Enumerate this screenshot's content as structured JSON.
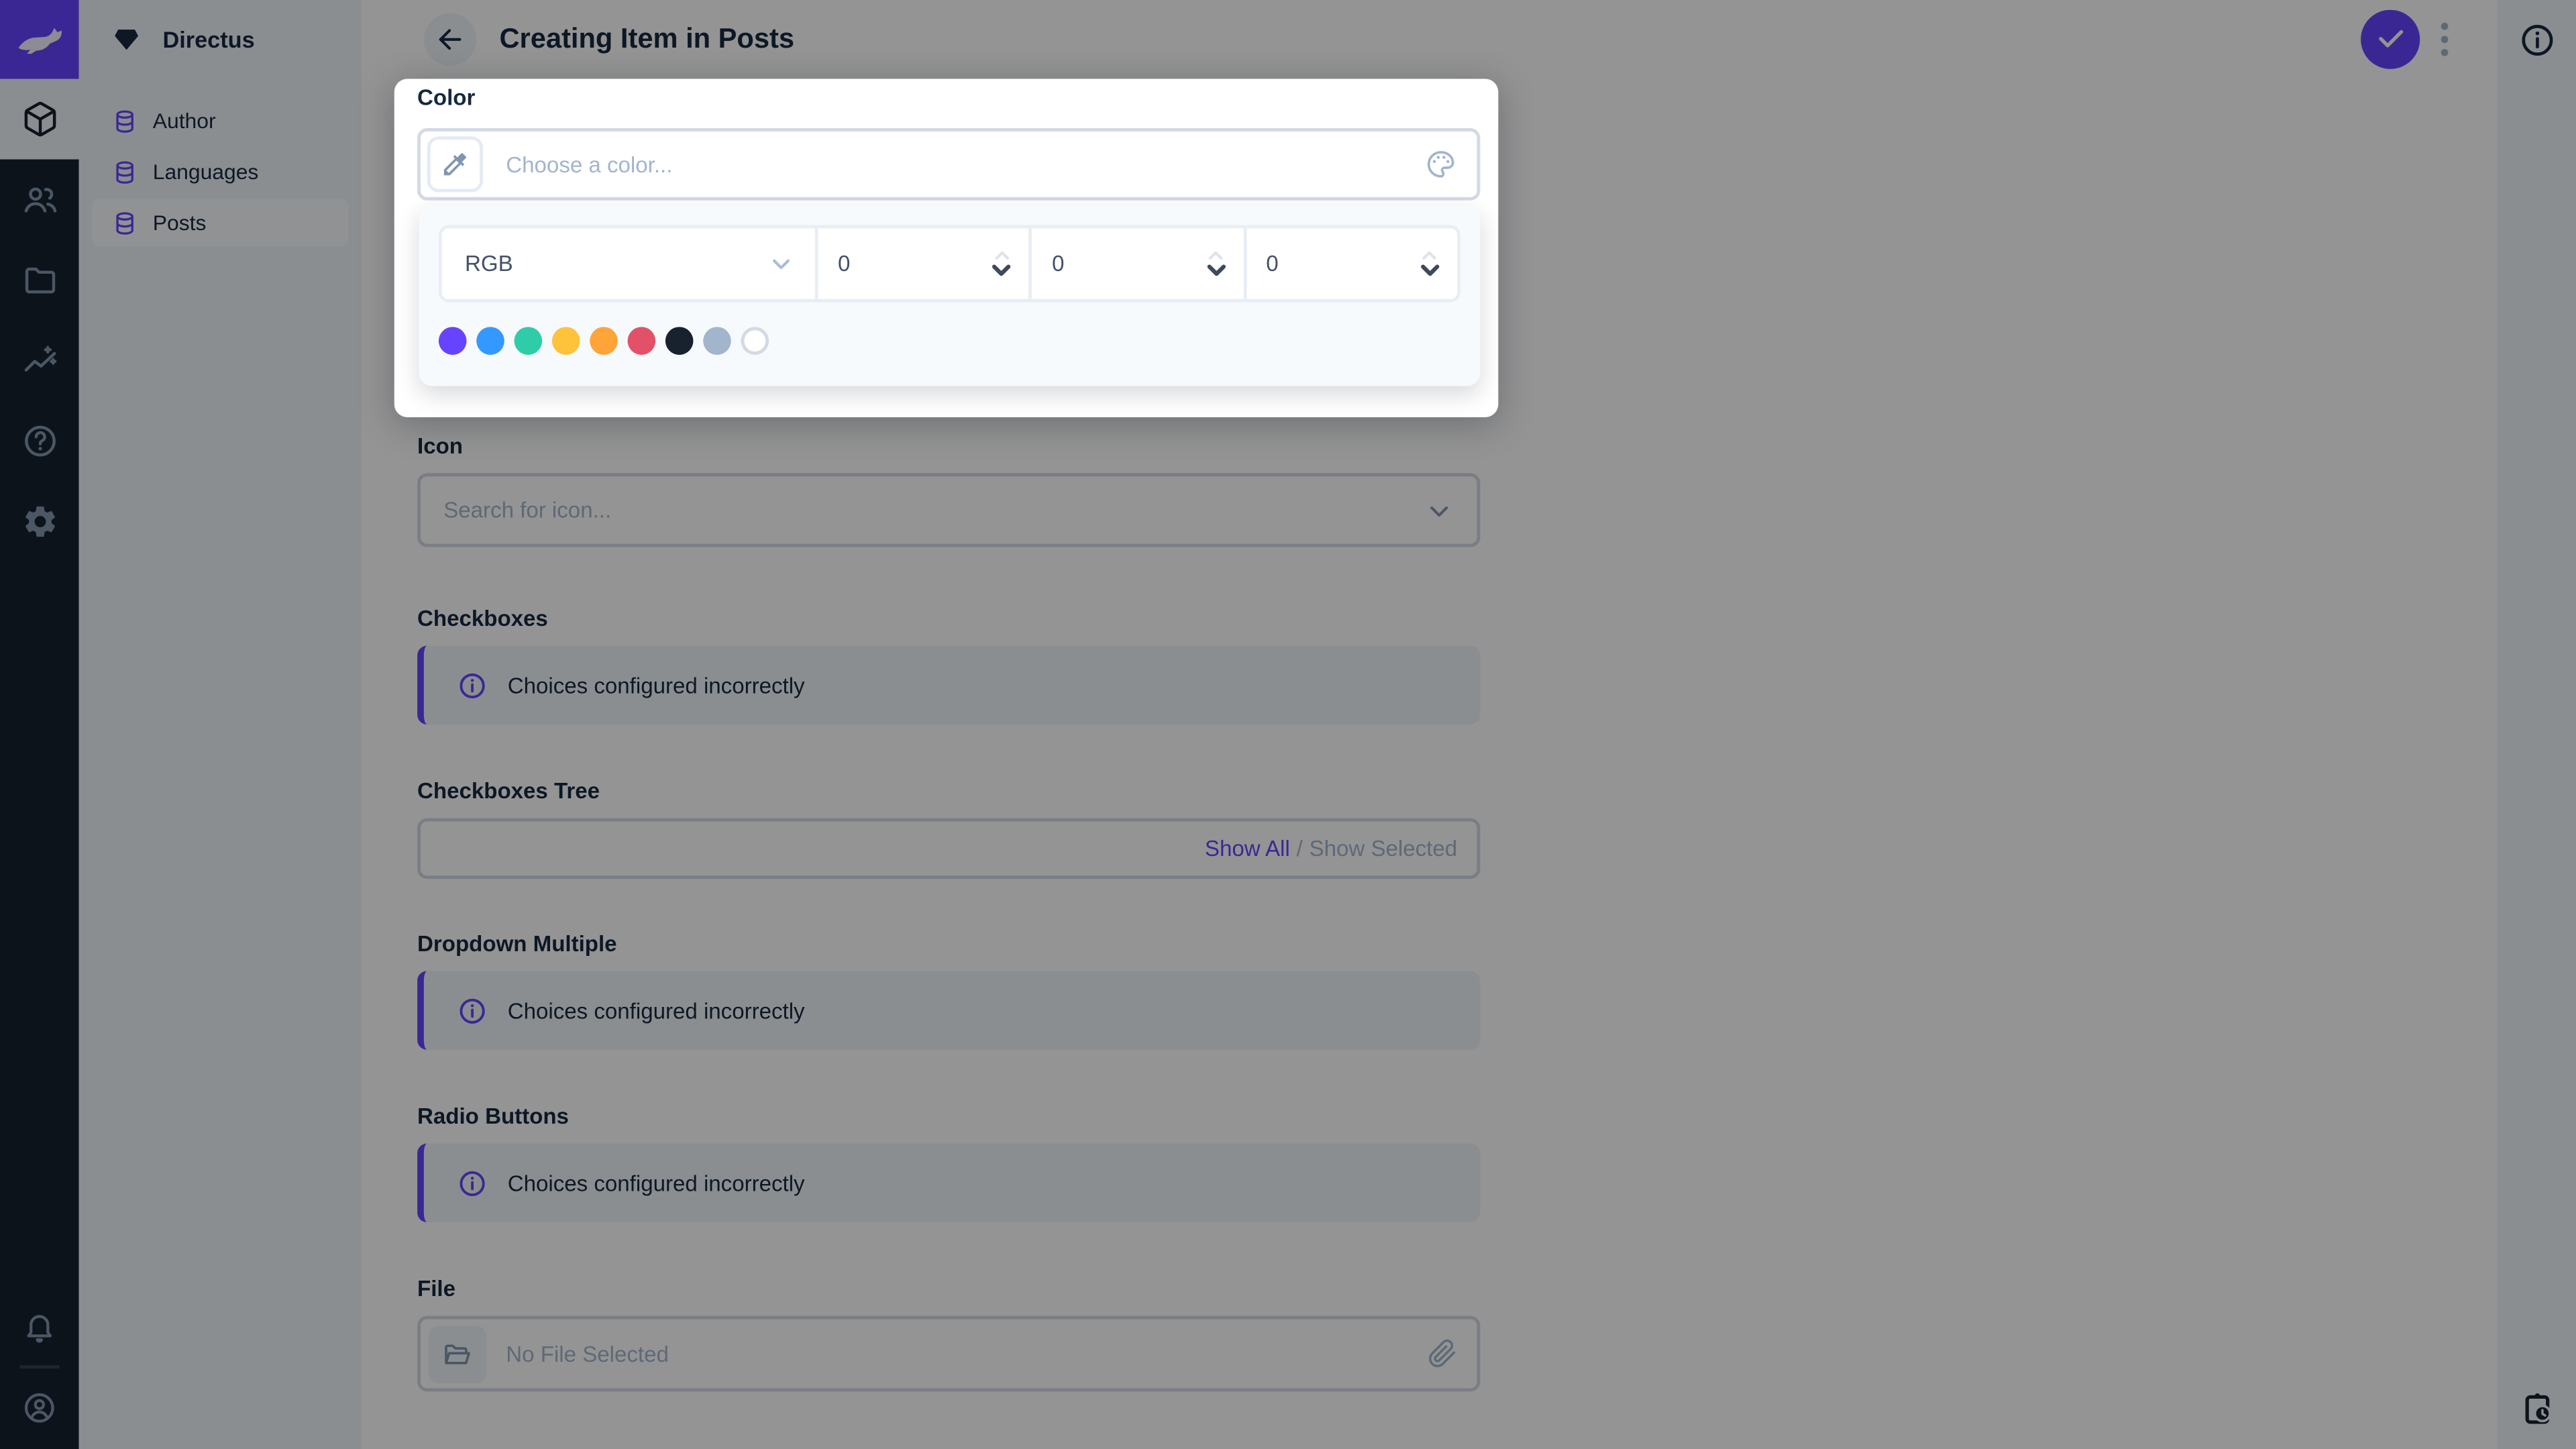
{
  "colors": {
    "accent": "#6644ff",
    "text_dark": "#172940",
    "placeholder": "#a2b5cd",
    "input_border": "#d3dae4",
    "module_bar_bg": "#18222f",
    "panel_bg": "#f0f4fa"
  },
  "icons": {
    "logo": "directus-rabbit",
    "modules": [
      "cube",
      "people",
      "folder",
      "insights",
      "help-circle",
      "gear"
    ],
    "module_bar_bottom": [
      "bell",
      "user-circle"
    ],
    "project": "diamond",
    "collection": "database",
    "back": "arrow-left",
    "save": "check",
    "more": "kebab-vertical",
    "info_sidebar": "info-circle",
    "revisions": "clipboard-clock",
    "eyedropper": "colorize",
    "palette": "palette",
    "select": "chevron-down",
    "file_browse": "folder-open",
    "attach": "paperclip",
    "notice": "info-circle"
  },
  "nav": {
    "project_name": "Directus",
    "items": [
      {
        "label": "Author"
      },
      {
        "label": "Languages"
      },
      {
        "label": "Posts",
        "active": true
      }
    ]
  },
  "header": {
    "title": "Creating Item in Posts"
  },
  "color_popup": {
    "field_label": "Color",
    "placeholder": "Choose a color...",
    "mode": "RGB",
    "values": [
      "0",
      "0",
      "0"
    ],
    "swatches": [
      "#6644FF",
      "#3399FF",
      "#2ECDA7",
      "#FFC23B",
      "#FFA439",
      "#E35169",
      "#18222F",
      "#A2B5CD",
      "#FFFFFF"
    ]
  },
  "fields": {
    "icon": {
      "label": "Icon",
      "placeholder": "Search for icon..."
    },
    "checkboxes": {
      "label": "Checkboxes",
      "notice": "Choices configured incorrectly"
    },
    "checkboxes_tree": {
      "label": "Checkboxes Tree",
      "show_all": "Show All",
      "separator": "/",
      "show_selected": "Show Selected"
    },
    "dropdown_multiple": {
      "label": "Dropdown Multiple",
      "notice": "Choices configured incorrectly"
    },
    "radio_buttons": {
      "label": "Radio Buttons",
      "notice": "Choices configured incorrectly"
    },
    "file": {
      "label": "File",
      "placeholder": "No File Selected"
    }
  }
}
